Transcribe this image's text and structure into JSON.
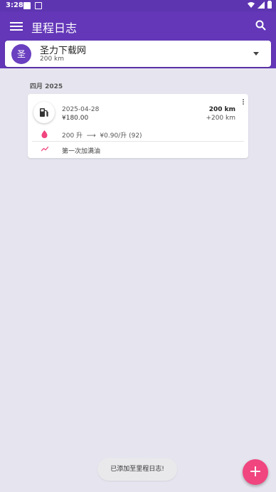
{
  "status_bar": {
    "time": "3:28"
  },
  "app_bar": {
    "title": "里程日志"
  },
  "vehicle": {
    "avatar_letter": "圣",
    "name": "圣力下载网",
    "distance": "200 km"
  },
  "month_header": "四月 2025",
  "entry": {
    "date": "2025-04-28",
    "price": "¥180.00",
    "odometer": "200 km",
    "distance_delta": "+200 km",
    "fuel_volume": "200 升",
    "unit_price": "¥0.90/升 (92)",
    "note": "第一次加满油"
  },
  "toast": "已添加至里程日志!",
  "fab": {
    "label": "+"
  },
  "colors": {
    "primary": "#6337b8",
    "accent": "#f0457f",
    "background": "#e6e5ef"
  }
}
